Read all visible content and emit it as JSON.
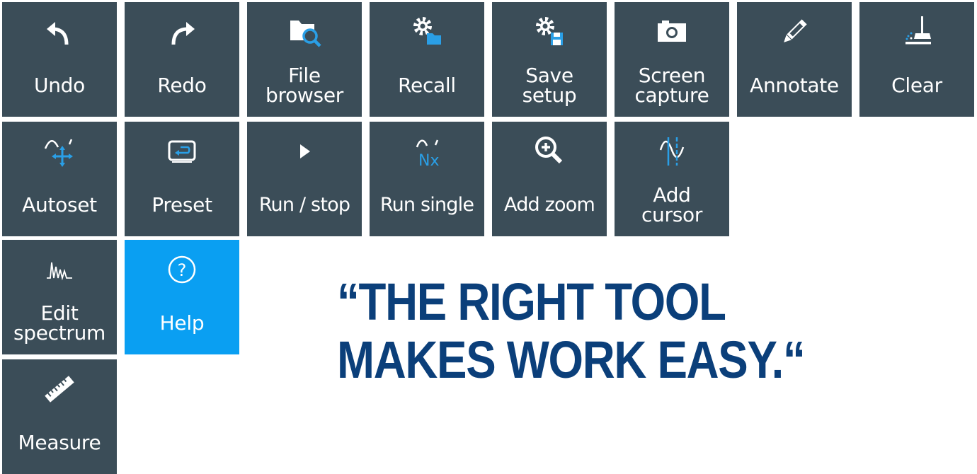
{
  "toolbar": {
    "row1": [
      {
        "label": "Undo",
        "icon": "undo-icon"
      },
      {
        "label": "Redo",
        "icon": "redo-icon"
      },
      {
        "label": "File\nbrowser",
        "icon": "file-browser-icon"
      },
      {
        "label": "Recall",
        "icon": "recall-icon"
      },
      {
        "label": "Save\nsetup",
        "icon": "save-setup-icon"
      },
      {
        "label": "Screen\ncapture",
        "icon": "camera-icon"
      },
      {
        "label": "Annotate",
        "icon": "pencil-icon"
      },
      {
        "label": "Clear",
        "icon": "clear-broom-icon"
      }
    ],
    "row2": [
      {
        "label": "Autoset",
        "icon": "autoset-icon"
      },
      {
        "label": "Preset",
        "icon": "preset-icon"
      },
      {
        "label": "Run / stop",
        "icon": "play-icon"
      },
      {
        "label": "Run single",
        "icon": "run-single-icon"
      },
      {
        "label": "Add zoom",
        "icon": "zoom-in-icon"
      },
      {
        "label": "Add\ncursor",
        "icon": "cursor-icon"
      }
    ],
    "row3": [
      {
        "label": "Edit\nspectrum",
        "icon": "spectrum-icon"
      },
      {
        "label": "Help",
        "icon": "help-icon",
        "active": true
      }
    ],
    "row4": [
      {
        "label": "Measure",
        "icon": "ruler-icon"
      }
    ]
  },
  "quote": {
    "line1": "“THE RIGHT TOOL",
    "line2": "MAKES WORK EASY.“"
  },
  "colors": {
    "tile": "#3b4d58",
    "tile_active": "#0a9ff2",
    "icon_accent": "#2a9fe6",
    "quote": "#0b3f7a"
  }
}
